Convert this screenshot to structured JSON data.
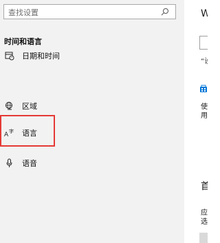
{
  "search": {
    "placeholder": "查找设置"
  },
  "sidebar": {
    "section_title": "时间和语言",
    "items": [
      {
        "label": "日期和时间",
        "icon": "calendar-clock-icon"
      },
      {
        "label": "区域",
        "icon": "globe-icon"
      },
      {
        "label": "语言",
        "icon": "language-icon",
        "highlighted": true
      },
      {
        "label": "语音",
        "icon": "microphone-icon"
      }
    ]
  },
  "content": {
    "partial_title": "W",
    "partial_quote": "“设",
    "partial_line1": "使",
    "partial_line2": "用",
    "partial_heading": "首",
    "partial_app1": "应",
    "partial_app2": "选"
  },
  "colors": {
    "highlight": "#e53935",
    "sidebar_bg": "#f2f2f2",
    "store_icon": "#0078d7"
  }
}
